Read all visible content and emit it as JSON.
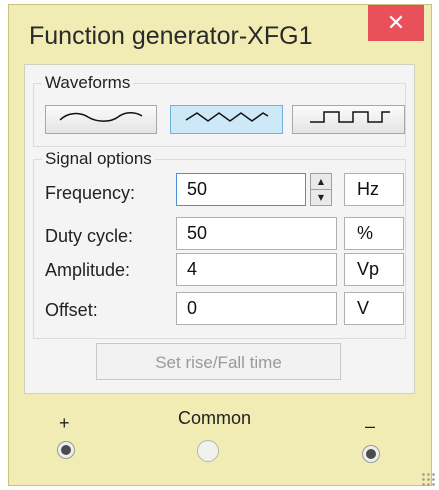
{
  "window": {
    "title": "Function generator-XFG1",
    "close_glyph": "✕",
    "accent_color": "#e8515a"
  },
  "waveforms": {
    "label": "Waveforms",
    "buttons": [
      {
        "icon": "sine-wave-icon",
        "selected": false
      },
      {
        "icon": "triangle-wave-icon",
        "selected": true
      },
      {
        "icon": "square-wave-icon",
        "selected": false
      }
    ]
  },
  "signal_options": {
    "label": "Signal options",
    "rows": [
      {
        "label": "Frequency:",
        "value": "50",
        "unit": "Hz"
      },
      {
        "label": "Duty cycle:",
        "value": "50",
        "unit": "%"
      },
      {
        "label": "Amplitude:",
        "value": "4",
        "unit": "Vp"
      },
      {
        "label": "Offset:",
        "value": "0",
        "unit": "V"
      }
    ],
    "rise_fall_label": "Set rise/Fall time"
  },
  "terminals": {
    "plus": "+",
    "common": "Common",
    "minus": "–"
  }
}
